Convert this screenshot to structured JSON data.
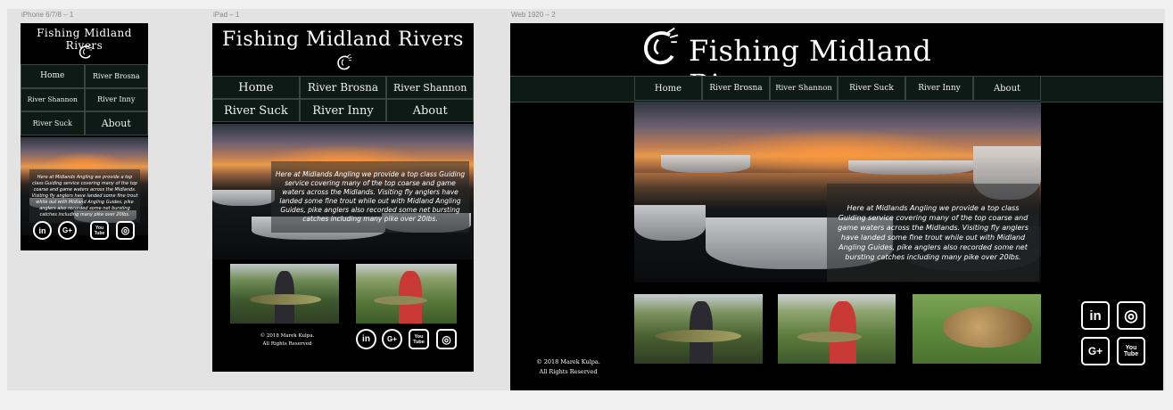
{
  "site": {
    "title": "Fishing Midland Rivers",
    "nav": [
      "Home",
      "River Brosna",
      "River Shannon",
      "River Suck",
      "River Inny",
      "About"
    ],
    "intro": "Here at Midlands Angling we provide a top class Guiding service covering many of the top coarse and game waters across the Midlands. Visiting fly anglers have landed some fine trout while out with Midland Angling Guides, pike anglers also recorded some net bursting catches including many pike over 20lbs.",
    "copyright": "© 2018 Marek Kulpa.",
    "rights": "All Rights Reserved",
    "social": [
      {
        "icon": "linkedin-icon",
        "label": "in"
      },
      {
        "icon": "google-plus-icon",
        "label": "G+"
      },
      {
        "icon": "youtube-icon",
        "label": "You Tube"
      },
      {
        "icon": "instagram-icon",
        "label": "◎"
      }
    ]
  },
  "artboards": {
    "phone": "iPhone 6/7/8 – 1",
    "tablet": "iPad – 1",
    "desktop": "Web 1920 – 2"
  },
  "colors": {
    "page_bg": "#000000",
    "nav_bg": "#0d1a16",
    "nav_border": "#38453f",
    "canvas_bg": "#e3e3e3"
  }
}
